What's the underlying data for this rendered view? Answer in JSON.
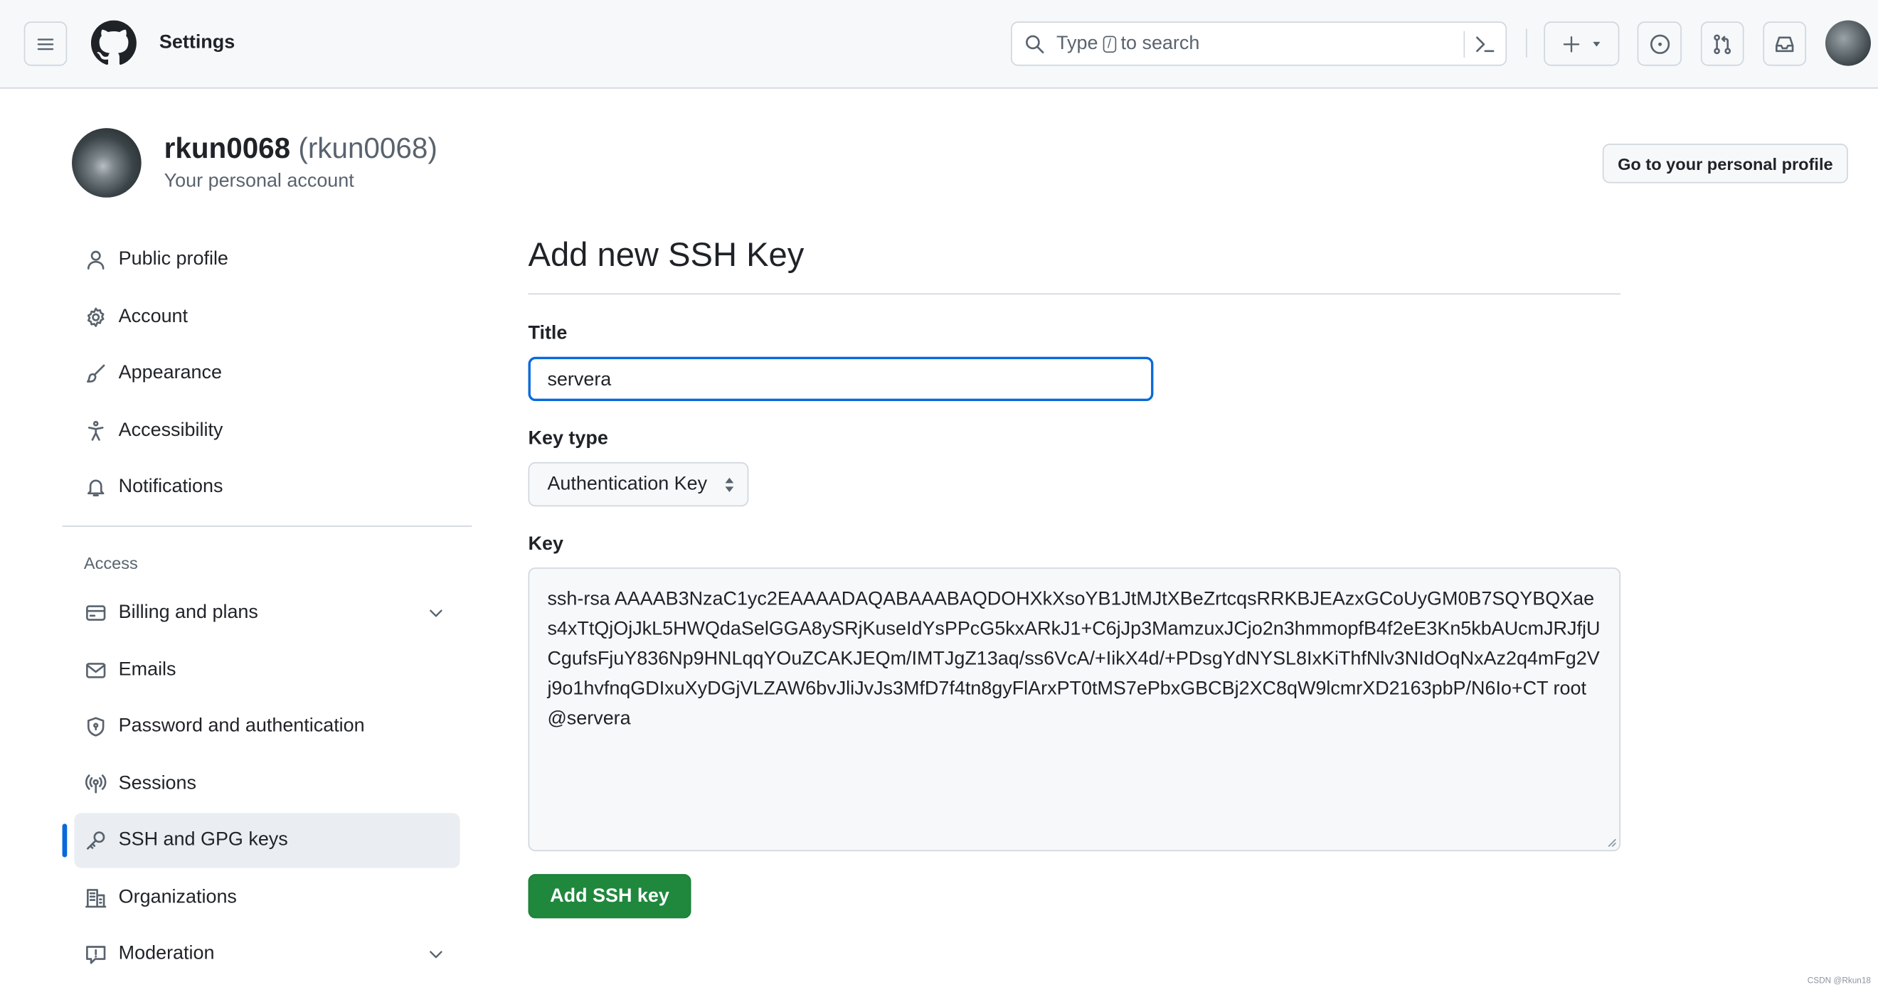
{
  "header": {
    "title": "Settings",
    "search_placeholder_pre": "Type",
    "search_key": "/",
    "search_placeholder_post": "to search"
  },
  "account": {
    "username": "rkun0068",
    "handle": "(rkun0068)",
    "subtitle": "Your personal account",
    "profile_button": "Go to your personal profile"
  },
  "sidebar": {
    "items": [
      {
        "label": "Public profile",
        "icon": "person-icon"
      },
      {
        "label": "Account",
        "icon": "gear-icon"
      },
      {
        "label": "Appearance",
        "icon": "paintbrush-icon"
      },
      {
        "label": "Accessibility",
        "icon": "accessibility-icon"
      },
      {
        "label": "Notifications",
        "icon": "bell-icon"
      }
    ],
    "section_label": "Access",
    "access_items": [
      {
        "label": "Billing and plans",
        "icon": "credit-card-icon",
        "expandable": true
      },
      {
        "label": "Emails",
        "icon": "mail-icon"
      },
      {
        "label": "Password and authentication",
        "icon": "shield-icon"
      },
      {
        "label": "Sessions",
        "icon": "broadcast-icon"
      },
      {
        "label": "SSH and GPG keys",
        "icon": "key-icon",
        "selected": true
      },
      {
        "label": "Organizations",
        "icon": "organization-icon"
      },
      {
        "label": "Moderation",
        "icon": "report-icon",
        "expandable": true
      }
    ]
  },
  "form": {
    "heading": "Add new SSH Key",
    "title_label": "Title",
    "title_value": "servera",
    "key_type_label": "Key type",
    "key_type_value": "Authentication Key",
    "key_label": "Key",
    "key_value": "ssh-rsa AAAAB3NzaC1yc2EAAAADAQABAAABAQDOHXkXsoYB1JtMJtXBeZrtcqsRRKBJEAzxGCoUyGM0B7SQYBQXaes4xTtQjOjJkL5HWQdaSelGGA8ySRjKuseIdYsPPcG5kxARkJ1+C6jJp3MamzuxJCjo2n3hmmopfB4f2eE3Kn5kbAUcmJRJfjUCgufsFjuY836Np9HNLqqYOuZCAKJEQm/IMTJgZ13aq/ss6VcA/+IikX4d/+PDsgYdNYSL8IxKiThfNlv3NIdOqNxAz2q4mFg2Vj9o1hvfnqGDIxuXyDGjVLZAW6bvJliJvJs3MfD7f4tn8gyFlArxPT0tMS7ePbxGBCBj2XC8qW9lcmrXD2163pbP/N6Io+CT root@servera",
    "submit_label": "Add SSH key"
  },
  "colors": {
    "accent": "#0969da",
    "primary_button": "#1f883d"
  },
  "watermark": "CSDN @Rkun18"
}
